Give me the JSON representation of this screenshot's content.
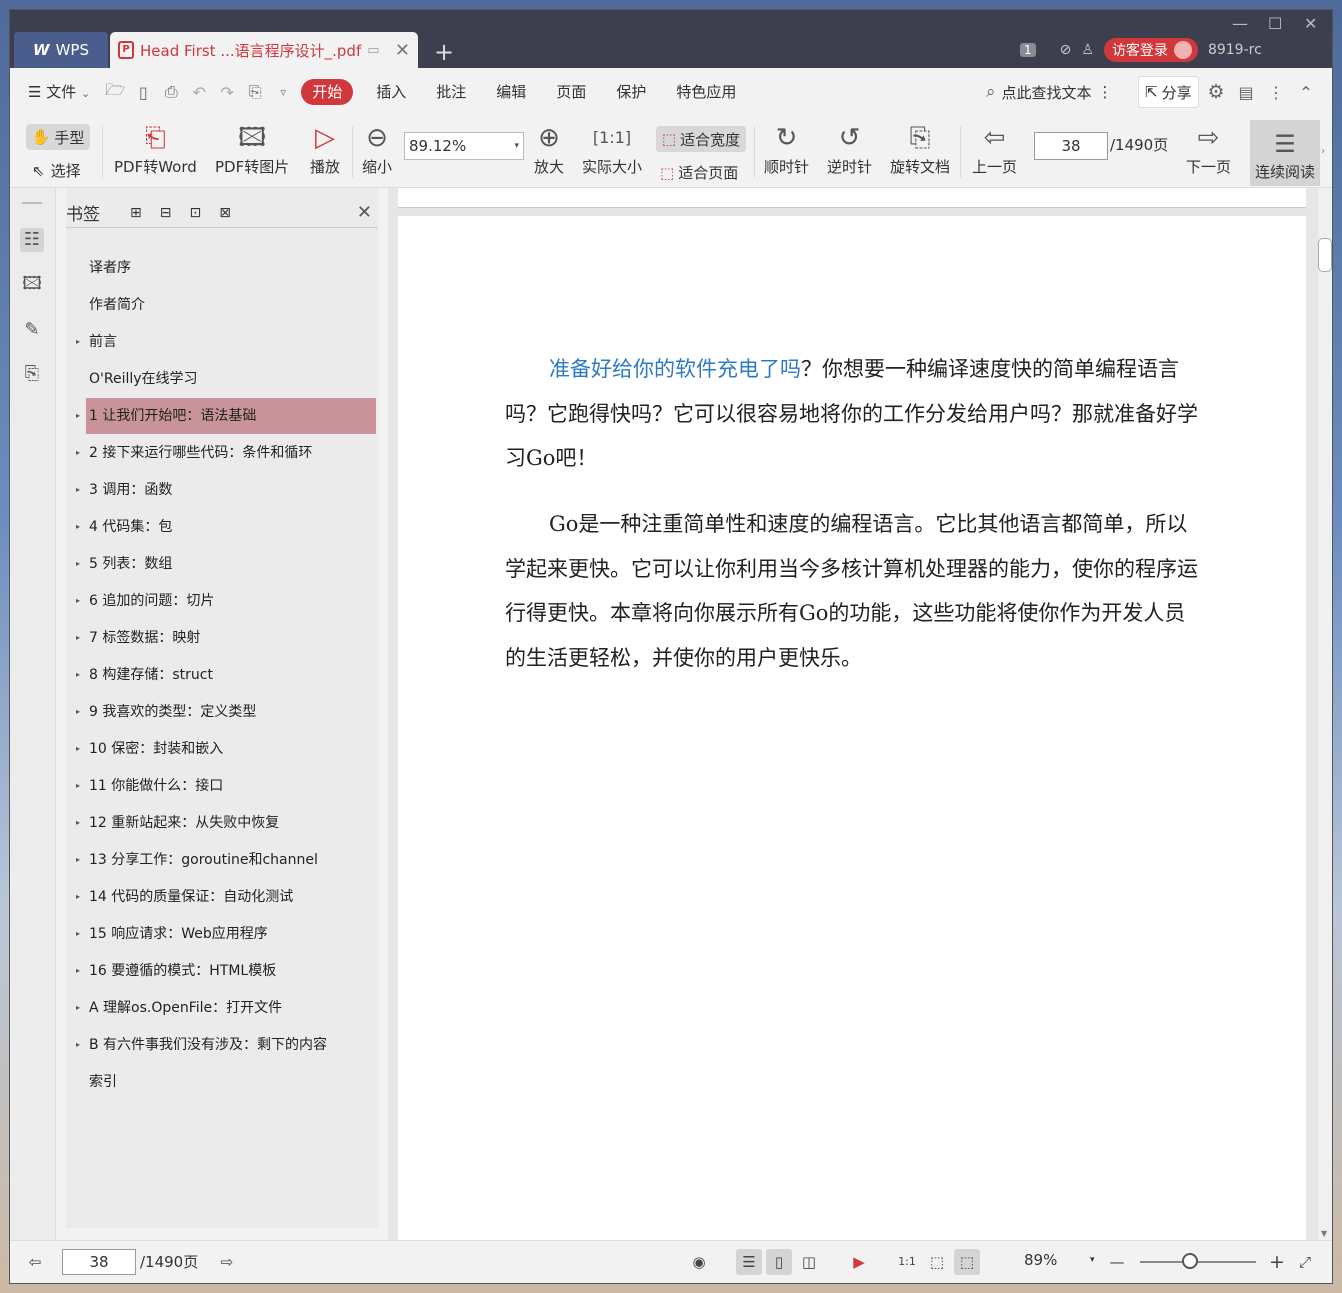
{
  "titlebar": {
    "wps_label": "WPS",
    "doc_tab_title": "Head First ...语言程序设计_.pdf",
    "count_badge": "1",
    "visitor_login": "访客登录",
    "build": "8919-rc"
  },
  "menu": {
    "file": "文件",
    "tabs": [
      "开始",
      "插入",
      "批注",
      "编辑",
      "页面",
      "保护",
      "特色应用"
    ],
    "search_placeholder": "点此查找文本",
    "share": "分享"
  },
  "toolbar": {
    "hand": "手型",
    "select": "选择",
    "pdf2word": "PDF转Word",
    "pdf2img": "PDF转图片",
    "play": "播放",
    "zoom_out": "缩小",
    "zoom_value": "89.12%",
    "zoom_in": "放大",
    "actual_size": "实际大小",
    "fit_width": "适合宽度",
    "fit_page": "适合页面",
    "clockwise": "顺时针",
    "counter_clockwise": "逆时针",
    "rotate_doc": "旋转文档",
    "prev_page": "上一页",
    "page_current": "38",
    "page_total": "/1490页",
    "next_page": "下一页",
    "continuous": "连续阅读"
  },
  "bookmarks": {
    "title": "书签",
    "items": [
      {
        "label": "译者序",
        "expandable": false
      },
      {
        "label": "作者简介",
        "expandable": false
      },
      {
        "label": "前言",
        "expandable": true
      },
      {
        "label": "O'Reilly在线学习",
        "expandable": false
      },
      {
        "label": "1 让我们开始吧：语法基础",
        "expandable": true,
        "selected": true
      },
      {
        "label": "2 接下来运行哪些代码：条件和循环",
        "expandable": true
      },
      {
        "label": "3 调用：函数",
        "expandable": true
      },
      {
        "label": "4 代码集：包",
        "expandable": true
      },
      {
        "label": "5 列表：数组",
        "expandable": true
      },
      {
        "label": "6 追加的问题：切片",
        "expandable": true
      },
      {
        "label": "7 标签数据：映射",
        "expandable": true
      },
      {
        "label": "8 构建存储：struct",
        "expandable": true
      },
      {
        "label": "9 我喜欢的类型：定义类型",
        "expandable": true
      },
      {
        "label": "10 保密：封装和嵌入",
        "expandable": true
      },
      {
        "label": "11 你能做什么：接口",
        "expandable": true
      },
      {
        "label": "12 重新站起来：从失败中恢复",
        "expandable": true
      },
      {
        "label": "13 分享工作：goroutine和channel",
        "expandable": true
      },
      {
        "label": "14 代码的质量保证：自动化测试",
        "expandable": true
      },
      {
        "label": "15 响应请求：Web应用程序",
        "expandable": true
      },
      {
        "label": "16 要遵循的模式：HTML模板",
        "expandable": true
      },
      {
        "label": "A 理解os.OpenFile：打开文件",
        "expandable": true
      },
      {
        "label": "B 有六件事我们没有涉及：剩下的内容",
        "expandable": true
      },
      {
        "label": "索引",
        "expandable": false
      }
    ]
  },
  "document": {
    "p1_highlight": "准备好给你的软件充电了吗",
    "p1_rest": "？你想要一种编译速度快的简单编程语言吗？它跑得快吗？它可以很容易地将你的工作分发给用户吗？那就准备好学习Go吧！",
    "p2": "Go是一种注重简单性和速度的编程语言。它比其他语言都简单，所以学起来更快。它可以让你利用当今多核计算机处理器的能力，使你的程序运行得更快。本章将向你展示所有Go的功能，这些功能将使你作为开发人员的生活更轻松，并使你的用户更快乐。"
  },
  "statusbar": {
    "page_current": "38",
    "page_total": "/1490页",
    "zoom": "89%"
  },
  "colors": {
    "accent": "#d0383c",
    "selected_bookmark": "#c8949a",
    "link_blue": "#2e7bc4"
  }
}
